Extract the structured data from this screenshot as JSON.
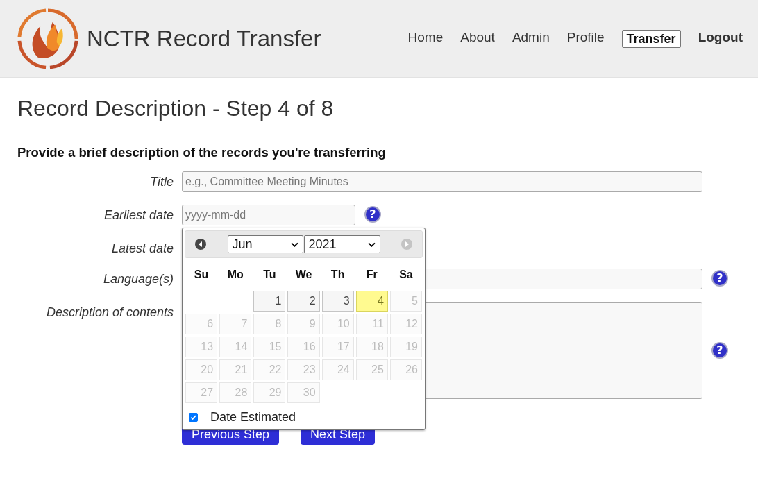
{
  "header": {
    "title": "NCTR Record Transfer",
    "nav": [
      {
        "label": "Home",
        "selected": false
      },
      {
        "label": "About",
        "selected": false
      },
      {
        "label": "Admin",
        "selected": false
      },
      {
        "label": "Profile",
        "selected": false
      },
      {
        "label": "Transfer",
        "selected": true
      },
      {
        "label": "Logout",
        "selected": false,
        "bold": true
      }
    ]
  },
  "heading": "Record Description - Step 4 of 8",
  "subheading": "Provide a brief description of the records you're transferring",
  "fields": [
    {
      "kind": "text",
      "label": "Title",
      "placeholder": "e.g., Committee Meeting Minutes",
      "help": false
    },
    {
      "kind": "date",
      "label": "Earliest date",
      "placeholder": "yyyy-mm-dd",
      "help": true
    },
    {
      "kind": "date",
      "label": "Latest date",
      "help": false
    },
    {
      "kind": "text",
      "label": "Language(s)",
      "help": true
    },
    {
      "kind": "textarea",
      "label": "Description of contents",
      "help": true
    }
  ],
  "help_label": "?",
  "buttons": [
    "Previous Step",
    "Next Step"
  ],
  "datepicker": {
    "month": "Jun",
    "year": "2021",
    "weekdays": [
      "Su",
      "Mo",
      "Tu",
      "We",
      "Th",
      "Fr",
      "Sa"
    ],
    "weeks": [
      [
        {
          "label": "1",
          "disabled": false,
          "today": false
        },
        {
          "label": "2",
          "disabled": false,
          "today": false
        },
        {
          "label": "3",
          "disabled": false,
          "today": false
        },
        {
          "label": "4",
          "disabled": false,
          "today": true
        },
        {
          "label": "5",
          "disabled": true,
          "today": false
        }
      ],
      [
        {
          "label": "6",
          "disabled": true,
          "today": false
        },
        {
          "label": "7",
          "disabled": true,
          "today": false
        },
        {
          "label": "8",
          "disabled": true,
          "today": false
        },
        {
          "label": "9",
          "disabled": true,
          "today": false
        },
        {
          "label": "10",
          "disabled": true,
          "today": false
        },
        {
          "label": "11",
          "disabled": true,
          "today": false
        },
        {
          "label": "12",
          "disabled": true,
          "today": false
        }
      ],
      [
        {
          "label": "13",
          "disabled": true,
          "today": false
        },
        {
          "label": "14",
          "disabled": true,
          "today": false
        },
        {
          "label": "15",
          "disabled": true,
          "today": false
        },
        {
          "label": "16",
          "disabled": true,
          "today": false
        },
        {
          "label": "17",
          "disabled": true,
          "today": false
        },
        {
          "label": "18",
          "disabled": true,
          "today": false
        },
        {
          "label": "19",
          "disabled": true,
          "today": false
        }
      ],
      [
        {
          "label": "20",
          "disabled": true,
          "today": false
        },
        {
          "label": "21",
          "disabled": true,
          "today": false
        },
        {
          "label": "22",
          "disabled": true,
          "today": false
        },
        {
          "label": "23",
          "disabled": true,
          "today": false
        },
        {
          "label": "24",
          "disabled": true,
          "today": false
        },
        {
          "label": "25",
          "disabled": true,
          "today": false
        },
        {
          "label": "26",
          "disabled": true,
          "today": false
        }
      ],
      [
        {
          "label": "27",
          "disabled": true,
          "today": false
        },
        {
          "label": "28",
          "disabled": true,
          "today": false
        },
        {
          "label": "29",
          "disabled": true,
          "today": false
        },
        {
          "label": "30",
          "disabled": true,
          "today": false
        }
      ]
    ],
    "prev_disabled": false,
    "next_disabled": true,
    "estimated": {
      "label": "Date Estimated",
      "checked": true
    }
  }
}
